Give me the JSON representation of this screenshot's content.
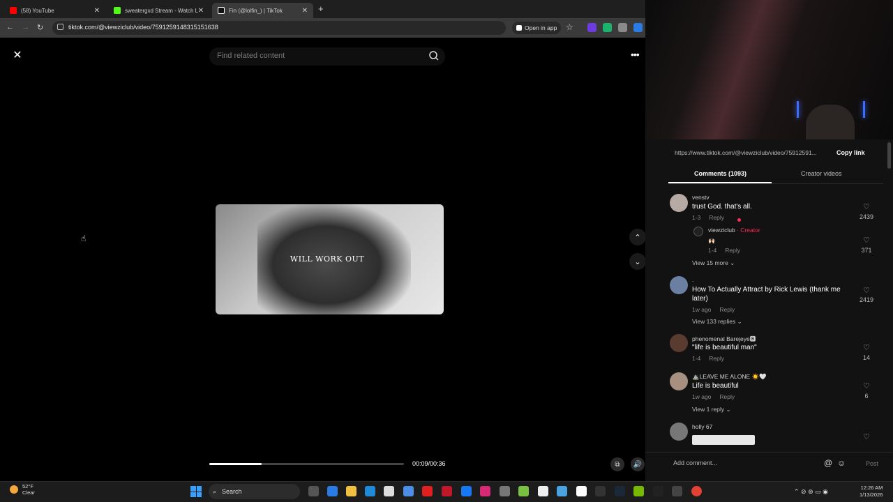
{
  "browser": {
    "tabs": [
      {
        "title": "(58) YouTube",
        "color": "#ff0000"
      },
      {
        "title": "sweatergxd Stream - Watch Live...",
        "color": "#53fc18"
      },
      {
        "title": "Fin (@lolfin_) | TikTok",
        "color": "#ffffff"
      }
    ],
    "close_glyph": "✕",
    "new_tab_glyph": "+",
    "url": "tiktok.com/@viewziclub/video/7591259148315151638",
    "open_in_app": "Open in app",
    "nav": {
      "back": "←",
      "forward": "→",
      "reload": "↻"
    }
  },
  "player": {
    "search_placeholder": "Find related content",
    "overlay_text": "WILL WORK OUT",
    "time": "00:09/00:36",
    "progress": 0.27,
    "close_glyph": "✕",
    "more_glyph": "•••",
    "up_glyph": "⌃",
    "down_glyph": "⌄",
    "cursor_glyph": "☝"
  },
  "panel": {
    "link": "https://www.tiktok.com/@viewziclub/video/75912591...",
    "copy_link": "Copy link",
    "tab_comments": "Comments (1093)",
    "tab_creator": "Creator videos",
    "comments": [
      {
        "user": "venstv",
        "text": "trust God. that's all.",
        "date": "1-3",
        "reply": "Reply",
        "likes": "2439",
        "avatar": "#b7a9a3"
      },
      {
        "user": "viewziclub",
        "creator_tag": " · Creator",
        "text": "🙌🏻",
        "date": "1-4",
        "reply": "Reply",
        "likes": "371"
      },
      {
        "user": ".",
        "text": "How To Actually Attract by Rick Lewis (thank me later)",
        "date": "1w ago",
        "reply": "Reply",
        "likes": "2419",
        "avatar": "#6b7fa3"
      },
      {
        "user": "phenomenal Barejeye🅱",
        "text": "\"life is beautiful man\"",
        "date": "1-4",
        "reply": "Reply",
        "likes": "14",
        "avatar": "#5a3b2f"
      },
      {
        "user": "⛰️LEAVE ME ALONE ☀️🤍",
        "text": "Life is beautiful",
        "date": "1w ago",
        "reply": "Reply",
        "likes": "6",
        "avatar": "#a89080"
      },
      {
        "user": "holly 67",
        "text": "",
        "date": "",
        "reply": "",
        "likes": "",
        "avatar": "#777777"
      }
    ],
    "view_more_1": "View 15 more ⌄",
    "view_more_2": "View 133 replies ⌄",
    "view_more_3": "View 1 reply ⌄",
    "add_comment": "Add comment...",
    "at_glyph": "@",
    "emoji_glyph": "☺",
    "post": "Post",
    "heart_glyph": "♡"
  },
  "taskbar": {
    "temp": "52°F",
    "condition": "Clear",
    "search": "Search",
    "time": "12:26 AM",
    "date": "1/13/2026",
    "tray_glyphs": "⌃  ⊘  ⊛  ▭  ◉"
  },
  "colors": {
    "accent": "#fe2c55",
    "start": "#3aa0ff"
  }
}
